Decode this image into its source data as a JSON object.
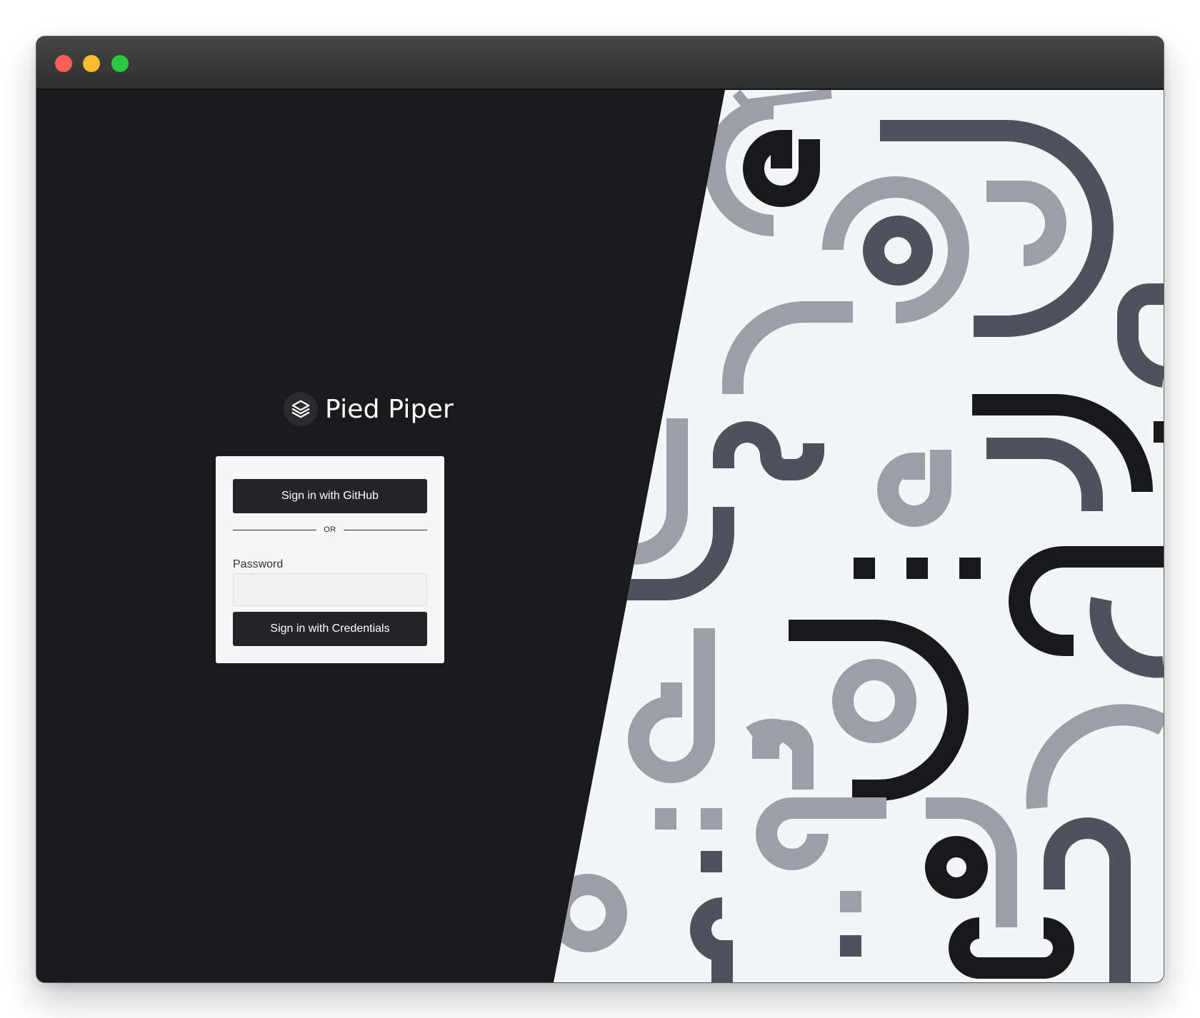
{
  "window": {
    "controls": [
      "close",
      "minimize",
      "zoom"
    ]
  },
  "brand": {
    "name": "Pied Piper",
    "logo_icon": "layers-icon"
  },
  "login": {
    "github_button_label": "Sign in with GitHub",
    "divider_text": "OR",
    "password_label": "Password",
    "password_value": "",
    "credentials_button_label": "Sign in with Credentials"
  },
  "colors": {
    "panel_dark": "#1a1a1c",
    "pattern_background": "#f4f5f6",
    "pattern_black": "#19191c",
    "pattern_dark_gray": "#51515b",
    "pattern_light_gray": "#9e9ea6",
    "button": "#252528"
  }
}
